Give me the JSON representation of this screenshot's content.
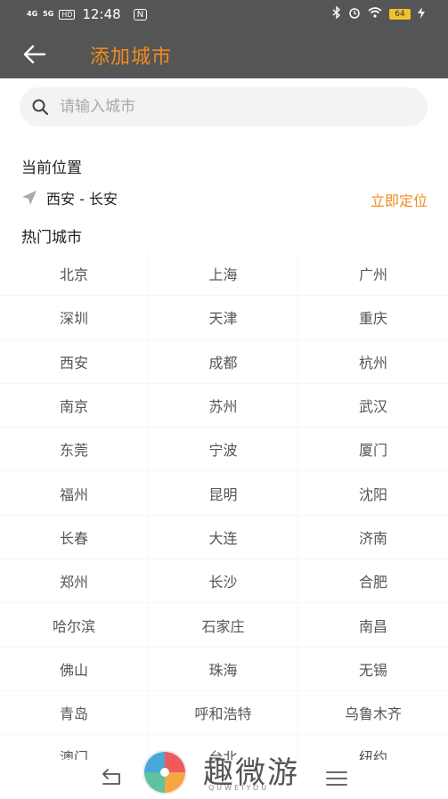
{
  "status_bar": {
    "network1": "4G",
    "network2": "5G",
    "hd_label": "HD",
    "time": "12:48",
    "nfc_label": "N",
    "battery_level": "64",
    "icons": [
      "bluetooth-icon",
      "alarm-icon",
      "wifi-icon",
      "battery-icon",
      "charging-icon"
    ]
  },
  "header": {
    "title": "添加城市",
    "back_icon": "arrow-left-icon"
  },
  "search": {
    "placeholder": "请输入城市",
    "value": ""
  },
  "current_location": {
    "title": "当前位置",
    "location": "西安 - 长安",
    "locate_label": "立即定位"
  },
  "hot_cities": {
    "title": "热门城市",
    "cities": [
      "北京",
      "上海",
      "广州",
      "深圳",
      "天津",
      "重庆",
      "西安",
      "成都",
      "杭州",
      "南京",
      "苏州",
      "武汉",
      "东莞",
      "宁波",
      "厦门",
      "福州",
      "昆明",
      "沈阳",
      "长春",
      "大连",
      "济南",
      "郑州",
      "长沙",
      "合肥",
      "哈尔滨",
      "石家庄",
      "南昌",
      "佛山",
      "珠海",
      "无锡",
      "青岛",
      "呼和浩特",
      "乌鲁木齐",
      "澳门",
      "台北",
      "纽约"
    ]
  },
  "watermark": {
    "text": "趣微游",
    "sub": "QUWEIYOU"
  },
  "colors": {
    "accent": "#f28a1e",
    "header_bg": "#555555",
    "search_bg": "#f3f3f3"
  }
}
